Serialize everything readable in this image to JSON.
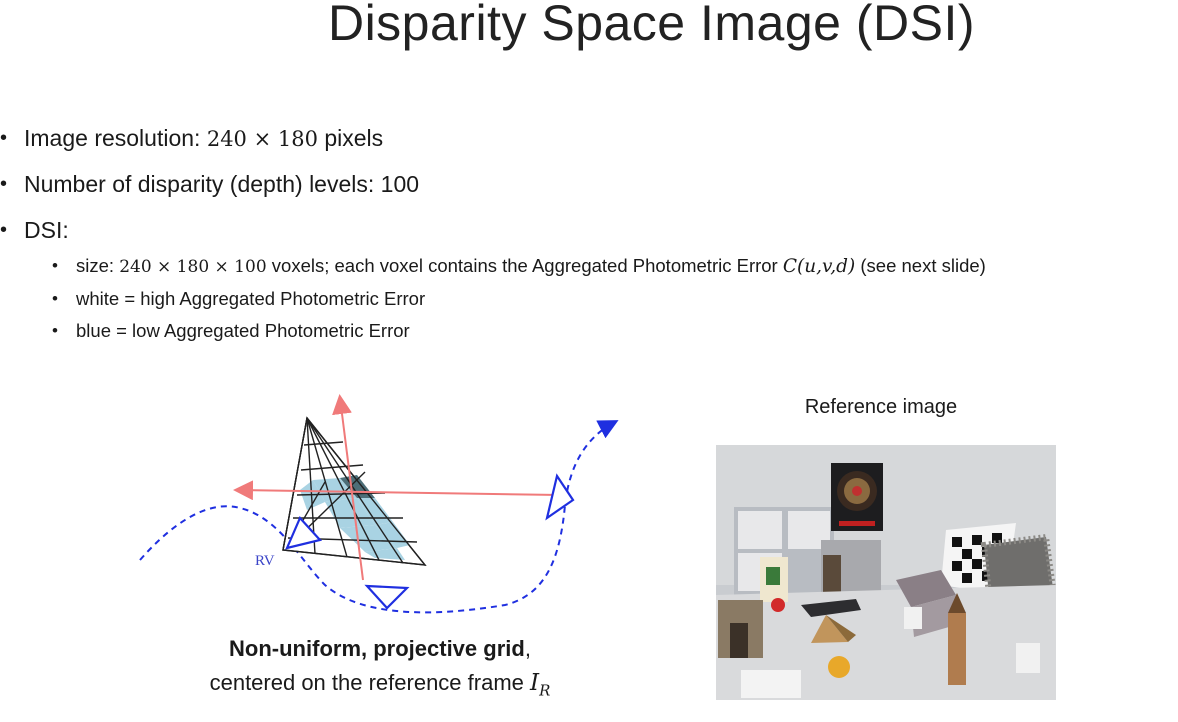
{
  "title": "Disparity Space Image (DSI)",
  "bullets": [
    {
      "prefix": "Image resolution: ",
      "math": "240 × 180",
      "suffix": " pixels"
    },
    {
      "text": "Number of disparity (depth) levels: 100"
    },
    {
      "text": "DSI:"
    }
  ],
  "sub_bullets": {
    "size": {
      "prefix": "size: ",
      "math": "240 × 180 × 100",
      "middle": " voxels; each voxel contains the Aggregated Photometric Error ",
      "func": "C(u,v,d)",
      "suffix": " (see next slide)"
    },
    "white": "white = high Aggregated Photometric Error",
    "blue": "blue = low Aggregated Photometric Error"
  },
  "diagram": {
    "rv_label": "RV"
  },
  "caption": {
    "bold": "Non-uniform, projective grid",
    "comma": ",",
    "line2": "centered on the reference frame ",
    "frame_symbol": "I",
    "frame_sub": "R"
  },
  "reference": {
    "label": "Reference image"
  },
  "colors": {
    "trajectory": "#1f2fe0",
    "axes": "#f07a7a",
    "voxel_fill": "#a9d3e3",
    "voxel_dark": "#4d6e78",
    "rv_label": "#3b45c8"
  }
}
